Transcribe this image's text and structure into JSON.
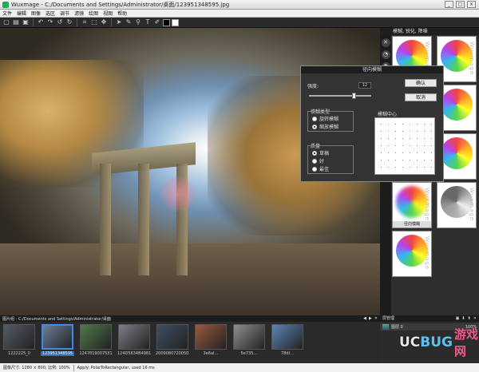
{
  "window": {
    "title": "Wuxmage - C:/Documents and Settings/Administrator/桌面/123951348595.jpg",
    "min": "_",
    "max": "□",
    "close": "×"
  },
  "menu": [
    "文件",
    "编辑",
    "图像",
    "选区",
    "调节",
    "滤镜",
    "绘图",
    "视图",
    "帮助"
  ],
  "toolbar": {
    "icons": [
      "new-icon",
      "open-icon",
      "save-icon",
      "undo-icon",
      "redo-icon",
      "rotate-left-icon",
      "rotate-right-icon",
      "crop-icon",
      "select-icon",
      "move-icon",
      "pointer-icon",
      "eyedropper-icon",
      "zoom-icon",
      "text-icon",
      "brush-icon"
    ],
    "glyphs": [
      "▢",
      "▤",
      "▣",
      "↶",
      "↷",
      "↺",
      "↻",
      "⌗",
      "⬚",
      "✥",
      "➤",
      "✎",
      "⚲",
      "T",
      "✐"
    ],
    "fg_color": "#000000",
    "bg_color": "#ffffff"
  },
  "right_panel": {
    "header": "模糊, 锐化, 降噪",
    "side_icons": [
      "✕",
      "◔",
      "✺",
      "◐"
    ],
    "tiles": [
      {
        "caption": "",
        "watermark": "Wuxmage",
        "style": "color"
      },
      {
        "caption": "",
        "watermark": "Wuxmage",
        "style": "color"
      },
      {
        "caption": "",
        "watermark": "",
        "style": "color"
      },
      {
        "caption": "",
        "watermark": "",
        "style": "color"
      },
      {
        "caption": "",
        "watermark": "",
        "style": "color"
      },
      {
        "caption": "",
        "watermark": "",
        "style": "color"
      },
      {
        "caption": "径向模糊",
        "watermark": "Wuxmage",
        "style": "blurt"
      },
      {
        "caption": "",
        "watermark": "Wuxmage",
        "style": "gray"
      },
      {
        "caption": "",
        "watermark": "Wuxmage",
        "style": "color"
      }
    ]
  },
  "dialog": {
    "title": "径向模糊",
    "strength_label": "强度:",
    "strength_value": "12",
    "strength_fraction": 0.72,
    "ok": "确认",
    "cancel": "取消",
    "blur_type": {
      "label": "模糊类型",
      "options": [
        "旋转模糊",
        "缩放模糊"
      ],
      "selected": 1
    },
    "quality": {
      "label": "质量",
      "options": [
        "草稿",
        "好",
        "最佳"
      ],
      "selected": 0
    },
    "center_label": "模糊中心"
  },
  "film": {
    "header": "图片组 - C:/Documents and Settings/Administrator/桌面",
    "nav": [
      "◀",
      "▶",
      "✕"
    ],
    "items": [
      {
        "name": "1222225_0",
        "color": "#555c66",
        "selected": false
      },
      {
        "name": "123951348595",
        "color": "#6b7f9a",
        "selected": true
      },
      {
        "name": "1247819007531",
        "color": "#4f7a4a",
        "selected": false
      },
      {
        "name": "124D5634B4981",
        "color": "#7d7f86",
        "selected": false
      },
      {
        "name": "20090807200507",
        "color": "#3e4f63",
        "selected": false
      },
      {
        "name": "3e6al…",
        "color": "#9a5a3a",
        "selected": false
      },
      {
        "name": "5e735…",
        "color": "#8f8f8f",
        "selected": false
      },
      {
        "name": "78dl…",
        "color": "#5a86b8",
        "selected": false
      }
    ]
  },
  "layers": {
    "header": "层管理",
    "row_name": "图层 0",
    "opacity": "100%",
    "icons": [
      "▣",
      "⬇",
      "⬆",
      "✕"
    ]
  },
  "watermark": {
    "part1": "UC",
    "part2": "BUG",
    "part3": "游戏网"
  },
  "status": {
    "size": "图像尺寸: 1280 × 800, 比例: 100%",
    "message": "Apply: PolarToRectangular, used 16 ms"
  }
}
